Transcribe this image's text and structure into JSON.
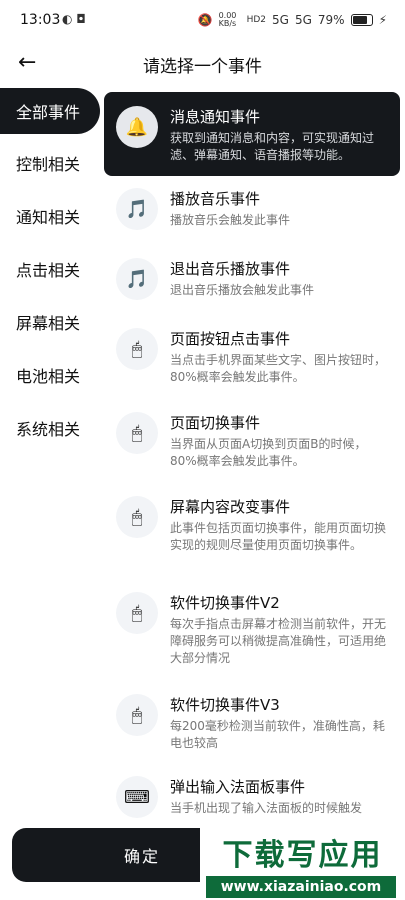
{
  "status_bar": {
    "time": "13:03",
    "speed": "0.00 KB/s",
    "hd": "HD2",
    "net1": "5G",
    "net2": "5G",
    "battery": "79%"
  },
  "header": {
    "title": "请选择一个事件",
    "back_icon": "arrow-left-icon"
  },
  "sidebar": {
    "items": [
      {
        "label": "全部事件"
      },
      {
        "label": "控制相关"
      },
      {
        "label": "通知相关"
      },
      {
        "label": "点击相关"
      },
      {
        "label": "屏幕相关"
      },
      {
        "label": "电池相关"
      },
      {
        "label": "系统相关"
      }
    ]
  },
  "events": [
    {
      "name": "消息通知事件",
      "desc": "获取到通知消息和内容，可实现通知过滤、弹幕通知、语音播报等功能。",
      "icon": "🔔",
      "icon_name": "bell-icon"
    },
    {
      "name": "播放音乐事件",
      "desc": "播放音乐会触发此事件",
      "icon": "🎵",
      "icon_name": "music-note-icon"
    },
    {
      "name": "退出音乐播放事件",
      "desc": "退出音乐播放会触发此事件",
      "icon": "🎵",
      "icon_name": "music-note-icon"
    },
    {
      "name": "页面按钮点击事件",
      "desc": "当点击手机界面某些文字、图片按钮时，80%概率会触发此事件。",
      "icon": "🖱",
      "icon_name": "mouse-icon"
    },
    {
      "name": "页面切换事件",
      "desc": "当界面从页面A切换到页面B的时候，80%概率会触发此事件。",
      "icon": "🖱",
      "icon_name": "mouse-icon"
    },
    {
      "name": "屏幕内容改变事件",
      "desc": "此事件包括页面切换事件，能用页面切换实现的规则尽量使用页面切换事件。",
      "icon": "🖱",
      "icon_name": "mouse-icon"
    },
    {
      "name": "软件切换事件V2",
      "desc": "每次手指点击屏幕才检测当前软件，开无障碍服务可以稍微提高准确性，可适用绝大部分情况",
      "icon": "🖱",
      "icon_name": "mouse-icon"
    },
    {
      "name": "软件切换事件V3",
      "desc": "每200毫秒检测当前软件，准确性高，耗电也较高",
      "icon": "🖱",
      "icon_name": "mouse-icon"
    },
    {
      "name": "弹出输入法面板事件",
      "desc": "当手机出现了输入法面板的时候触发",
      "icon": "⌨",
      "icon_name": "keyboard-icon"
    }
  ],
  "footer": {
    "confirm_label": "确定"
  },
  "watermark": {
    "main": "下载写应用",
    "url": "www.xiazainiao.com"
  }
}
